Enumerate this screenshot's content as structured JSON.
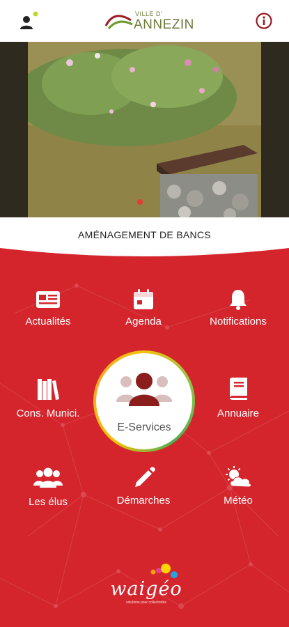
{
  "header": {
    "logo_small": "VILLE D'",
    "logo_main": "ANNEZIN"
  },
  "hero": {
    "caption": "AMÉNAGEMENT DE BANCS"
  },
  "menu": {
    "actualites": "Actualités",
    "agenda": "Agenda",
    "notifications": "Notifications",
    "cons_munici": "Cons. Munici.",
    "eservices": "E-Services",
    "annuaire": "Annuaire",
    "les_elus": "Les élus",
    "demarches": "Démarches",
    "meteo": "Météo"
  },
  "footer": {
    "brand": "waigéo",
    "brand_tagline": "solutions pour collectivités"
  },
  "colors": {
    "primary_red": "#d4252d",
    "text_white": "#ffffff",
    "logo_green": "#6b7b3a",
    "notification_dot": "#c6d52a",
    "eservices_ring": "#f4c20d"
  },
  "icons": {
    "profile": "profile-icon",
    "info": "info-icon",
    "newspaper": "newspaper-icon",
    "calendar": "calendar-icon",
    "bell": "bell-icon",
    "books": "books-icon",
    "group": "group-icon",
    "book": "book-icon",
    "people": "people-icon",
    "pencil": "pencil-icon",
    "weather": "sun-cloud-icon"
  }
}
